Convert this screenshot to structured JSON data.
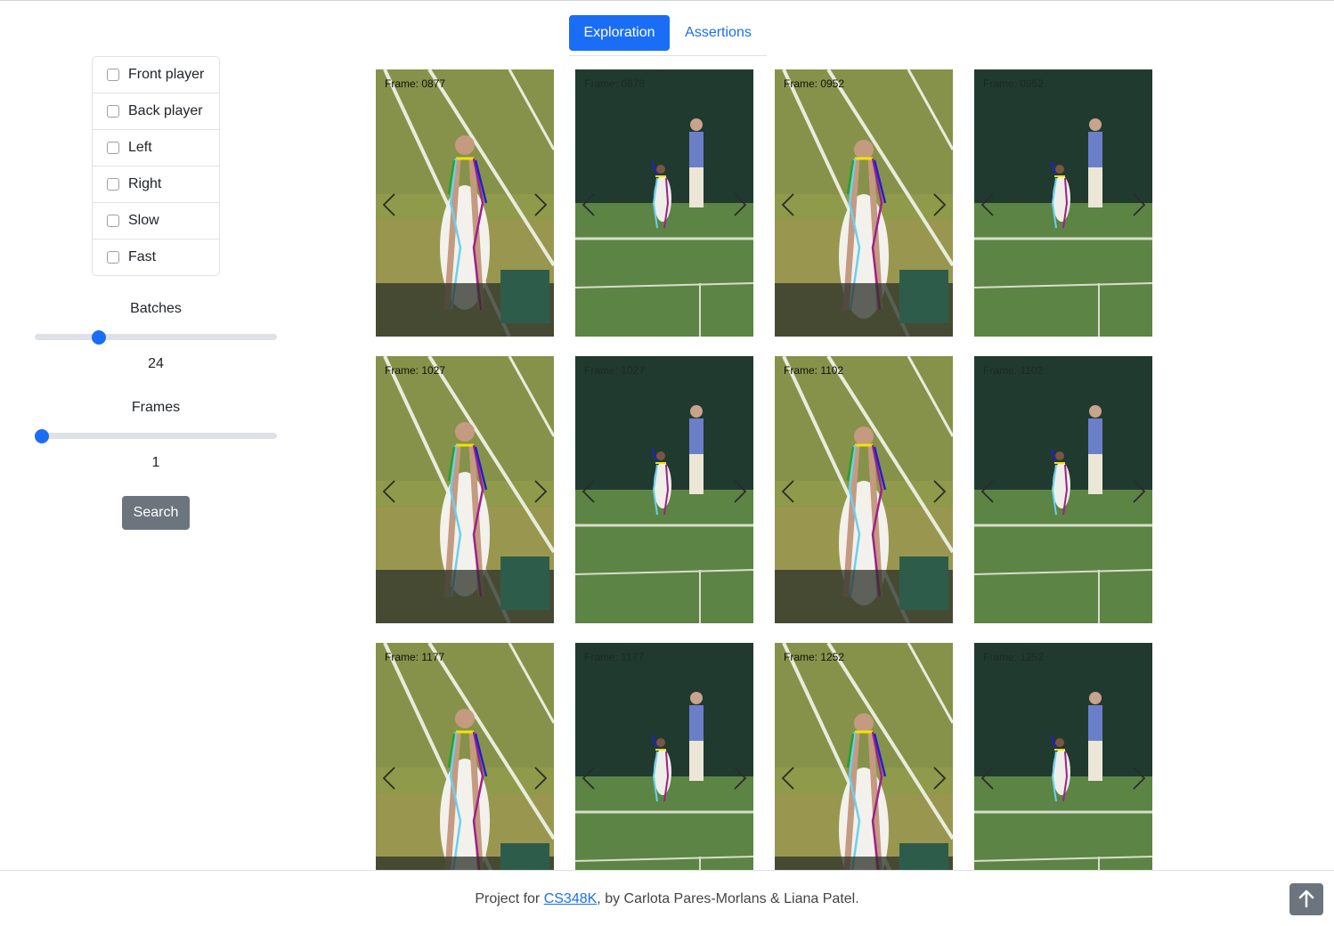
{
  "tabs": [
    {
      "label": "Exploration",
      "active": true
    },
    {
      "label": "Assertions",
      "active": false
    }
  ],
  "filters": [
    {
      "label": "Front player",
      "checked": false
    },
    {
      "label": "Back player",
      "checked": false
    },
    {
      "label": "Left",
      "checked": false
    },
    {
      "label": "Right",
      "checked": false
    },
    {
      "label": "Slow",
      "checked": false
    },
    {
      "label": "Fast",
      "checked": false
    }
  ],
  "batches": {
    "title": "Batches",
    "value": "24",
    "fraction": 0.25
  },
  "frames": {
    "title": "Frames",
    "value": "1",
    "fraction": 0.0
  },
  "search_label": "Search",
  "grid": [
    {
      "label": "Frame: 0877",
      "view": "near"
    },
    {
      "label": "Frame: 0878",
      "view": "far"
    },
    {
      "label": "Frame: 0952",
      "view": "near"
    },
    {
      "label": "Frame: 0952",
      "view": "far"
    },
    {
      "label": "Frame: 1027",
      "view": "near"
    },
    {
      "label": "Frame: 1027",
      "view": "far"
    },
    {
      "label": "Frame: 1102",
      "view": "near"
    },
    {
      "label": "Frame: 1102",
      "view": "far"
    },
    {
      "label": "Frame: 1177",
      "view": "near"
    },
    {
      "label": "Frame: 1177",
      "view": "far"
    },
    {
      "label": "Frame: 1252",
      "view": "near"
    },
    {
      "label": "Frame: 1252",
      "view": "far"
    }
  ],
  "footer": {
    "prefix": "Project for ",
    "link": "CS348K",
    "suffix": ", by Carlota Pares-Morlans & Liana Patel."
  },
  "colors": {
    "accent": "#1a6ef5",
    "secondary": "#6c757d",
    "grass_near": "#8f9a4a",
    "grass_far": "#4f7d3f",
    "wall": "#213a2f"
  },
  "icons": [
    "checkbox-icon",
    "chevron-left-icon",
    "chevron-right-icon",
    "arrow-up-icon"
  ]
}
